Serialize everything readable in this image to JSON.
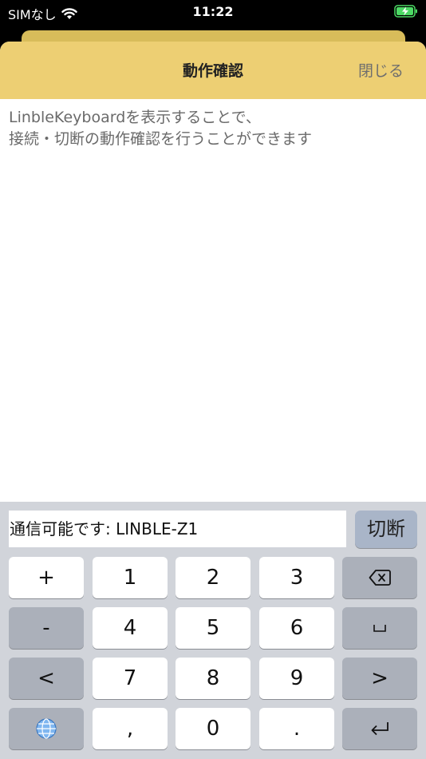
{
  "status_bar": {
    "carrier": "SIMなし",
    "time": "11:22",
    "icons": [
      "wifi-icon",
      "battery-charging-icon"
    ]
  },
  "nav": {
    "title": "動作確認",
    "close": "閉じる"
  },
  "message": {
    "line1": "LinbleKeyboardを表示することで、",
    "line2": "接続・切断の動作確認を行うことができます"
  },
  "keyboard": {
    "status_text": "通信可能です: LINBLE-Z1",
    "disconnect_label": "切断",
    "keys": {
      "plus": "+",
      "one": "1",
      "two": "2",
      "three": "3",
      "minus": "-",
      "four": "4",
      "five": "5",
      "six": "6",
      "lt": "<",
      "seven": "7",
      "eight": "8",
      "nine": "9",
      "gt": ">",
      "comma": ",",
      "zero": "0",
      "period": "."
    }
  },
  "colors": {
    "header_yellow": "#edcf73",
    "keyboard_bg": "#d1d4da",
    "function_key": "#abb0ba",
    "disconnect_button": "#a9b5c8"
  }
}
